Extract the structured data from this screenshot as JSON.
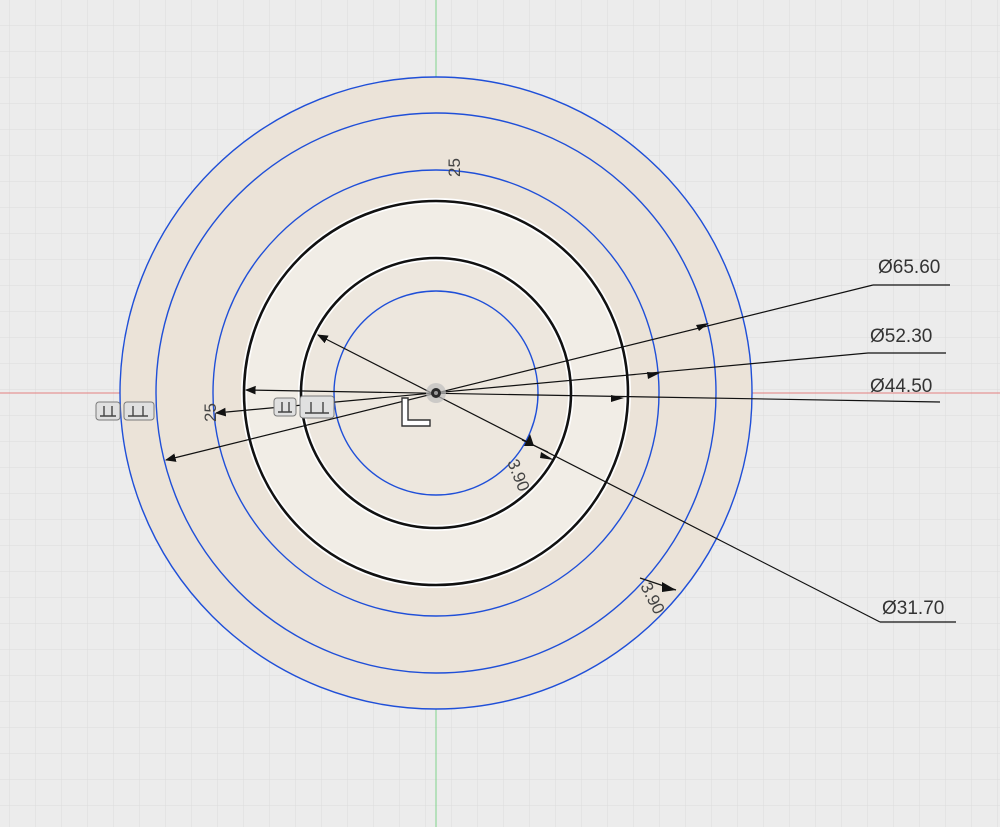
{
  "app": {
    "view": "sketch-canvas"
  },
  "colors": {
    "background": "#ececec",
    "grid_minor": "#dcdcdc",
    "grid_major": "#c9c9c9",
    "x_axis": "#e35a5a",
    "y_axis": "#5cc46b",
    "profile_fill": "#ece4d9",
    "inner_fill": "#f2efe9",
    "construction_blue": "#1f4fd8",
    "sketch_line": "#111111",
    "dimension_line": "#111111"
  },
  "dimensions": {
    "dia_65": "Ø65.60",
    "dia_52": "Ø52.30",
    "dia_44": "Ø44.50",
    "dia_31": "Ø31.70",
    "offset_inner": "3.90",
    "offset_outer": "3.90",
    "vert_25": "25",
    "horiz_25": "25"
  },
  "icons": {
    "origin": "origin-point-icon",
    "axis_glyph": "sketch-axis-glyph-icon",
    "constraint": "horizontal-constraint-icon"
  }
}
